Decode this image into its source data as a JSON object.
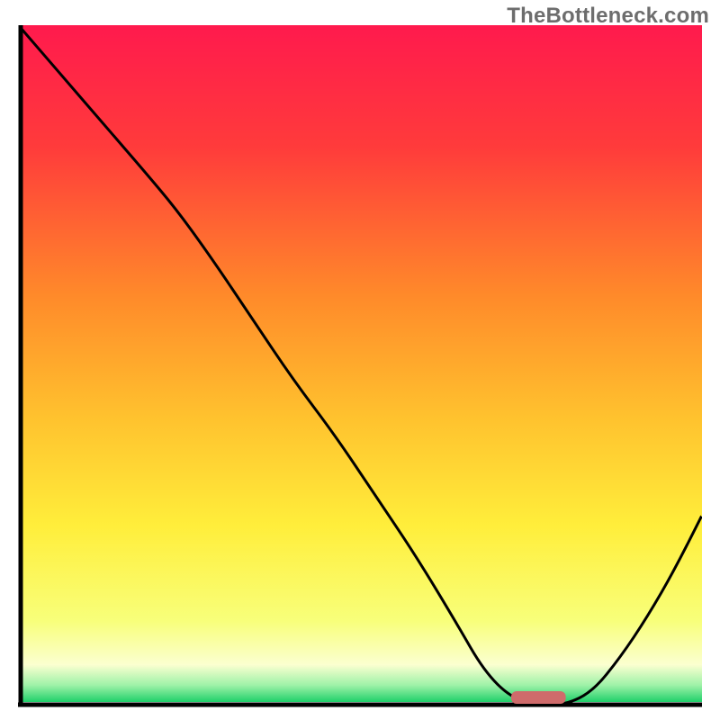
{
  "watermark": "TheBottleneck.com",
  "chart_data": {
    "type": "line",
    "title": "",
    "xlabel": "",
    "ylabel": "",
    "xlim": [
      0,
      100
    ],
    "ylim": [
      0,
      100
    ],
    "grid": false,
    "legend": false,
    "series": [
      {
        "name": "curve",
        "color": "#000000",
        "x": [
          0,
          6,
          12,
          18,
          23,
          28,
          34,
          40,
          46,
          52,
          58,
          64,
          68,
          72,
          76,
          80,
          84,
          88,
          92,
          96,
          100
        ],
        "y": [
          100,
          93,
          86,
          79,
          73,
          66,
          57,
          48,
          40,
          31,
          22,
          12,
          5,
          1,
          0,
          0,
          2,
          7,
          13,
          20,
          28
        ]
      },
      {
        "name": "marker",
        "kind": "segment",
        "color": "#cf6b6b",
        "x": [
          72,
          80
        ],
        "y": [
          0,
          0
        ]
      }
    ],
    "background_gradient": {
      "type": "vertical",
      "stops": [
        {
          "pos": 0.0,
          "color": "#ff1a4d"
        },
        {
          "pos": 0.18,
          "color": "#ff3b3b"
        },
        {
          "pos": 0.4,
          "color": "#ff8a2a"
        },
        {
          "pos": 0.58,
          "color": "#ffc22e"
        },
        {
          "pos": 0.74,
          "color": "#ffee3b"
        },
        {
          "pos": 0.88,
          "color": "#f8ff7a"
        },
        {
          "pos": 0.945,
          "color": "#fbffd0"
        },
        {
          "pos": 0.975,
          "color": "#9ff2a8"
        },
        {
          "pos": 1.0,
          "color": "#1fd06a"
        }
      ]
    }
  }
}
